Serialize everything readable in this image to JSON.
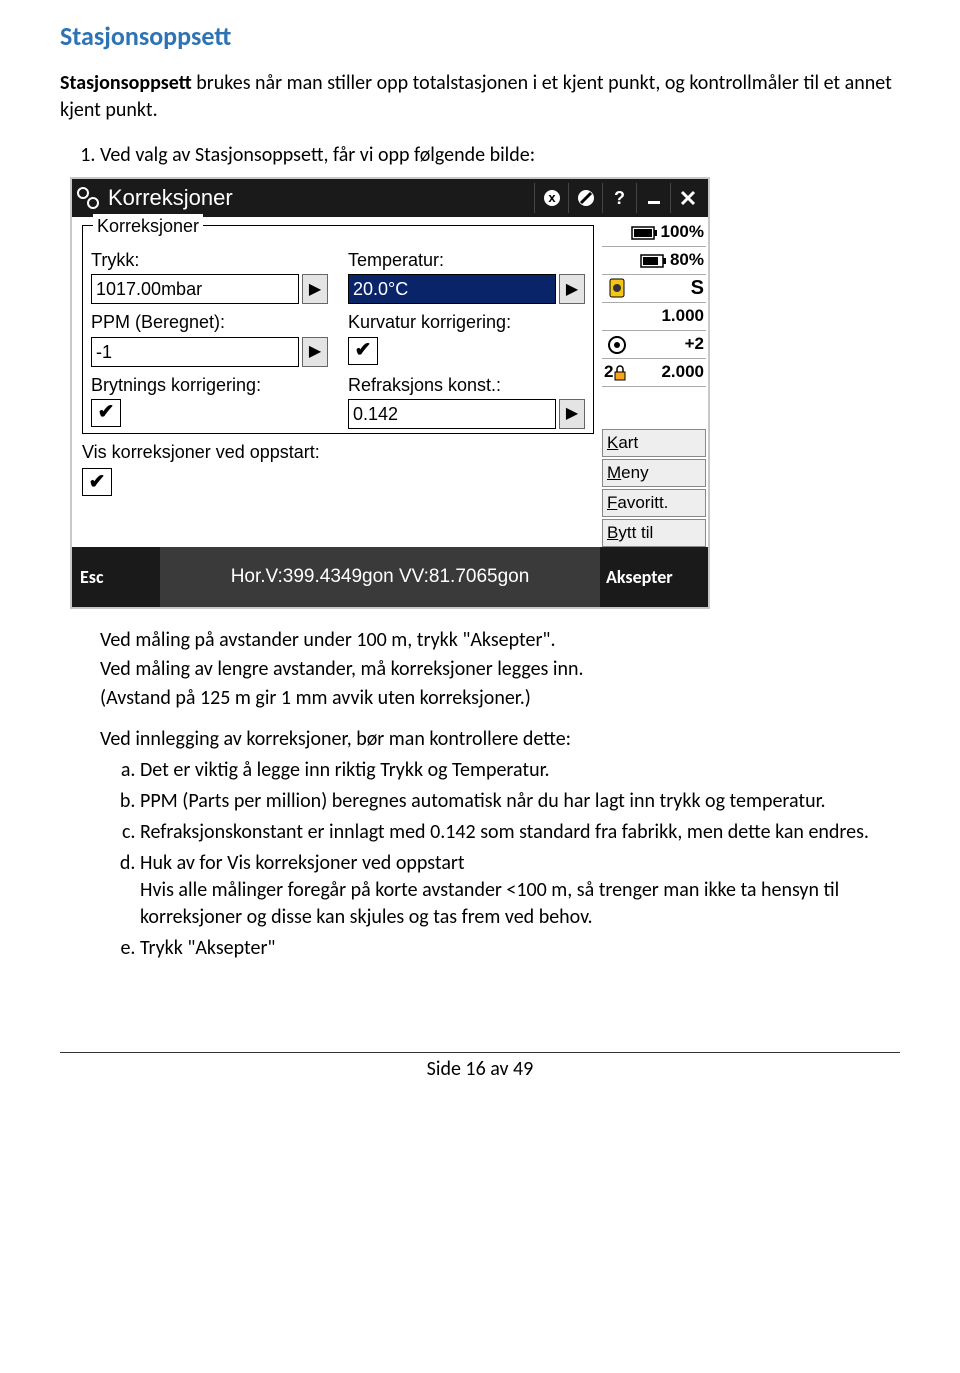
{
  "heading": "Stasjonsoppsett",
  "intro_bold": "Stasjonsoppsett",
  "intro_rest": " brukes når man stiller opp totalstasjonen i et kjent punkt, og kontrollmåler til et annet kjent punkt.",
  "step1": "Ved valg av Stasjonsoppsett, får vi opp følgende bilde:",
  "screenshot": {
    "titlebar": {
      "title": "Korreksjoner"
    },
    "fieldset_legend": "Korreksjoner",
    "labels": {
      "trykk": "Trykk:",
      "temperatur": "Temperatur:",
      "ppm": "PPM (Beregnet):",
      "kurvatur": "Kurvatur korrigering:",
      "brytning": "Brytnings korrigering:",
      "refraksjon": "Refraksjons konst.:",
      "vis": "Vis korreksjoner ved oppstart:"
    },
    "values": {
      "trykk": "1017.00mbar",
      "temperatur": "20.0°C",
      "ppm": "-1",
      "refraksjon": "0.142"
    },
    "side": {
      "bat1": "100%",
      "bat2": "80%",
      "s_label": "S",
      "s_val": "1.000",
      "plus2": "+2",
      "two_val": "2.000",
      "kart": "Kart",
      "meny": "Meny",
      "favoritt": "Favoritt.",
      "bytt": "Bytt til"
    },
    "bottom": {
      "esc": "Esc",
      "coords": "Hor.V:399.4349gon  VV:81.7065gon",
      "aksepter": "Aksepter"
    }
  },
  "para1": "Ved måling på avstander under 100 m, trykk \"Aksepter\".",
  "para2": "Ved måling av lengre avstander, må korreksjoner legges inn.",
  "para3": "(Avstand på 125 m gir 1 mm avvik uten korreksjoner.)",
  "para4": "Ved innlegging av korreksjoner, bør man kontrollere dette:",
  "sublist": {
    "a": "Det er viktig å legge inn riktig Trykk og Temperatur.",
    "b": "PPM (Parts per million) beregnes automatisk når du har lagt inn trykk og temperatur.",
    "c": "Refraksjonskonstant er innlagt med 0.142 som standard fra fabrikk, men dette kan endres.",
    "d": "Huk av for Vis korreksjoner ved oppstart\nHvis alle målinger foregår på korte avstander <100 m, så trenger man ikke ta hensyn til korreksjoner og disse kan skjules og tas frem ved behov.",
    "e": "Trykk \"Aksepter\""
  },
  "footer": "Side 16 av 49"
}
